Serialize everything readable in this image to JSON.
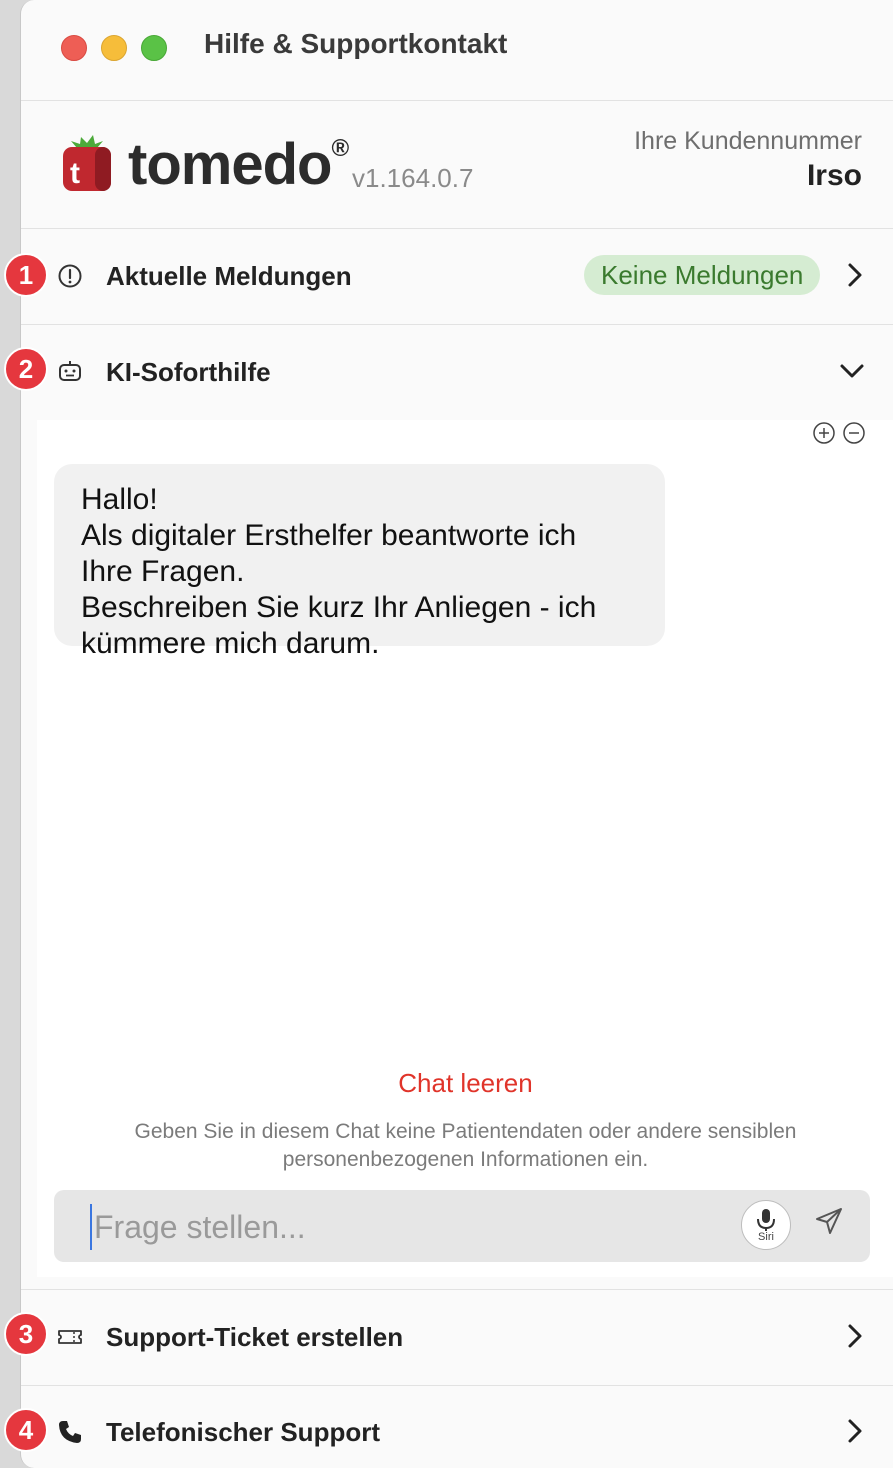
{
  "window": {
    "title": "Hilfe & Supportkontakt"
  },
  "brand": {
    "logo_letter": "t",
    "name": "tomedo",
    "registered": "®",
    "version": "v1.164.0.7",
    "customer_label": "Ihre Kundennummer",
    "customer_value": "Irso"
  },
  "sections": {
    "news": {
      "label": "Aktuelle Meldungen",
      "badge": "Keine Meldungen"
    },
    "ai": {
      "label": "KI-Soforthilfe"
    },
    "ticket": {
      "label": "Support-Ticket erstellen"
    },
    "phone": {
      "label": "Telefonischer Support"
    }
  },
  "chat": {
    "message_lines": [
      "Hallo!",
      "Als digitaler Ersthelfer beantworte ich",
      "Ihre Fragen.",
      "Beschreiben Sie kurz Ihr Anliegen - ich",
      "kümmere mich darum."
    ],
    "clear_label": "Chat leeren",
    "disclaimer": "Geben Sie in diesem Chat keine Patientendaten oder andere sensiblen personenbezogenen Informationen ein.",
    "input_placeholder": "Frage stellen...",
    "siri_label": "Siri"
  },
  "markers": [
    "1",
    "2",
    "3",
    "4"
  ],
  "colors": {
    "accent_red": "#e0342a",
    "badge_bg": "#d5ecd2",
    "badge_text": "#3a7a2e",
    "marker": "#e5373e"
  },
  "icons": {
    "news": "exclamation-circle-icon",
    "ai": "robot-icon",
    "ticket": "ticket-icon",
    "phone": "phone-icon"
  }
}
